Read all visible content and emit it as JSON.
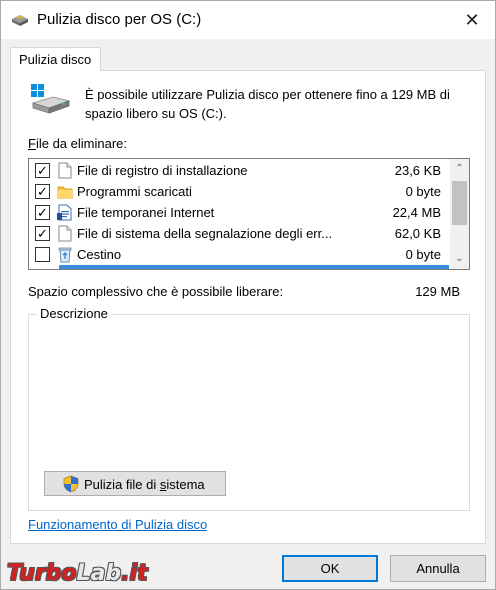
{
  "window": {
    "title": "Pulizia disco per OS (C:)",
    "close_symbol": "✕"
  },
  "tab": {
    "label": "Pulizia disco"
  },
  "intro": {
    "text": "È possibile utilizzare Pulizia disco per ottenere fino a 129 MB di spazio libero su OS (C:)."
  },
  "files": {
    "label_accel": "F",
    "label_rest": "ile da eliminare:",
    "items": [
      {
        "checked": true,
        "icon": "blank-file-icon",
        "name": "File di registro di installazione",
        "size": "23,6 KB"
      },
      {
        "checked": true,
        "icon": "folder-icon",
        "name": "Programmi scaricati",
        "size": "0 byte"
      },
      {
        "checked": true,
        "icon": "document-icon",
        "name": "File temporanei Internet",
        "size": "22,4 MB"
      },
      {
        "checked": true,
        "icon": "blank-file-icon",
        "name": "File di sistema della segnalazione degli err...",
        "size": "62,0 KB"
      },
      {
        "checked": false,
        "icon": "recycle-bin-icon",
        "name": "Cestino",
        "size": "0 byte"
      }
    ]
  },
  "total": {
    "label": "Spazio complessivo che è possibile liberare:",
    "value": "129 MB"
  },
  "description": {
    "label": "Descrizione"
  },
  "system_button": {
    "label_pre": "Pulizia file di ",
    "label_accel": "s",
    "label_post": "istema"
  },
  "help_link": {
    "label": "Funzionamento di Pulizia disco"
  },
  "buttons": {
    "ok": "OK",
    "cancel": "Annulla"
  },
  "watermark": {
    "part1": "Turbo",
    "part2": "Lab",
    "part3": ".it"
  },
  "colors": {
    "accent": "#0078d7",
    "selection": "#3a8ee0",
    "link": "#0066cc"
  }
}
